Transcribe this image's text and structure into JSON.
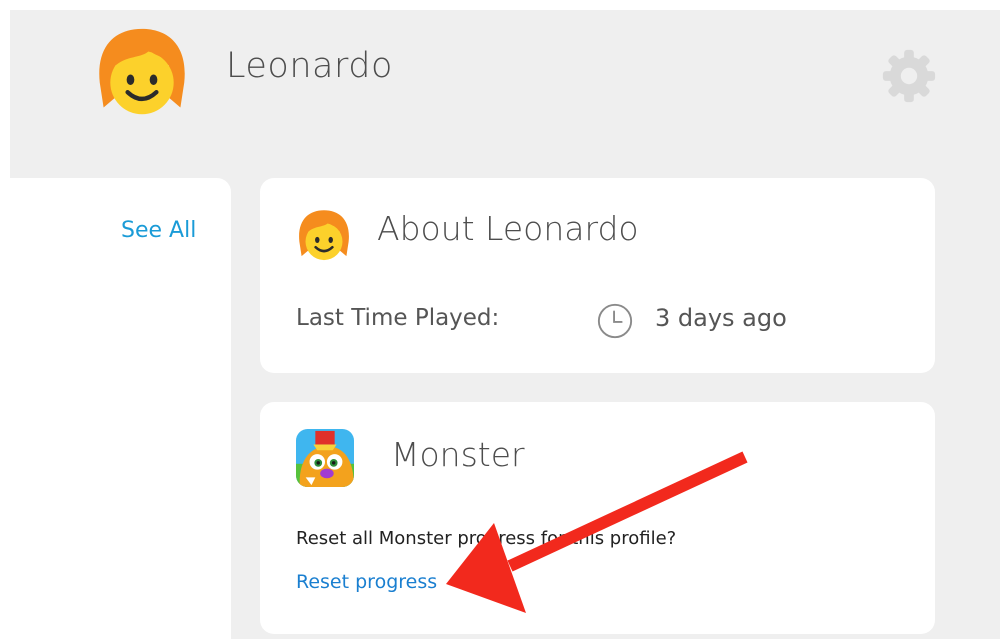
{
  "profile": {
    "name": "Leonardo",
    "avatar_icon": "child-face-avatar-icon"
  },
  "header": {
    "settings_icon": "gear-icon"
  },
  "sidebar": {
    "see_all_label": "See All"
  },
  "about_card": {
    "title": "About Leonardo",
    "last_played_label": "Last Time Played:",
    "last_played_icon": "clock-icon",
    "last_played_value": "3 days ago"
  },
  "monster_card": {
    "title": "Monster",
    "app_icon": "monster-app-icon",
    "reset_question": "Reset all Monster progress for this profile?",
    "reset_link_label": "Reset progress"
  },
  "annotation": {
    "arrow_color": "#f2291d"
  },
  "colors": {
    "link": "#1a9bd7",
    "page_background": "#efefef",
    "card_background": "#ffffff"
  }
}
